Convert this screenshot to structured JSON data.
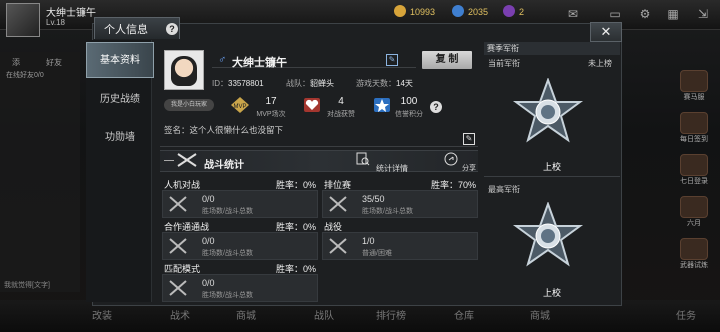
{
  "background": {
    "player_name": "大绅士镰午",
    "player_level": "Lv.18",
    "currency_1": "10993",
    "currency_2": "2035",
    "currency_3": "2",
    "left_tab_1": "添",
    "left_tab_2": "好友",
    "left_text": "在线好友0/0",
    "left_bottom_text": "我就觉得[文字]",
    "right_items": [
      "赛马服",
      "每日签到",
      "七日登录",
      "六月",
      "武器试炼"
    ],
    "bottom_nav": [
      "改装",
      "战术",
      "商城",
      "战队",
      "排行榜",
      "仓库",
      "商城",
      "任务"
    ]
  },
  "dialog": {
    "title": "个人信息",
    "help": "?",
    "close": "✕",
    "sidebar": [
      {
        "label": "基本资料",
        "active": true
      },
      {
        "label": "历史战绩",
        "active": false
      },
      {
        "label": "功勋墙",
        "active": false
      }
    ]
  },
  "profile": {
    "gender_symbol": "♂",
    "name": "大绅士镰午",
    "copy_label": "复 制",
    "id_label": "ID：",
    "id_value": "33578801",
    "team_label": "战队：",
    "team_value": "貂蝉头",
    "days_label": "游戏天数：",
    "days_value": "14天",
    "badge_text": "我是小白玩家",
    "stats": [
      {
        "value": "17",
        "label": "MVP场次",
        "icon": "mvp-icon"
      },
      {
        "value": "4",
        "label": "对战获赞",
        "icon": "heart-icon"
      },
      {
        "value": "100",
        "label": "信誉积分",
        "icon": "star-icon"
      }
    ],
    "signature": "签名：这个人很懒什么也没留下",
    "battle_title": "战斗统计",
    "detail_label": "统计详情",
    "share_label": "分享"
  },
  "battle_cards": [
    {
      "title": "人机对战",
      "rate": "胜率：0%",
      "value": "0/0",
      "sub": "胜场数/战斗总数"
    },
    {
      "title": "排位赛",
      "rate": "胜率：70%",
      "value": "35/50",
      "sub": "胜场数/战斗总数"
    },
    {
      "title": "合作通通战",
      "rate": "胜率：0%",
      "value": "0/0",
      "sub": "胜场数/战斗总数"
    },
    {
      "title": "战役",
      "rate": "",
      "value": "1/0",
      "sub": "普通/困难"
    },
    {
      "title": "匹配模式",
      "rate": "胜率：0%",
      "value": "0/0",
      "sub": "胜场数/战斗总数"
    }
  ],
  "rank": {
    "header": "赛季军衔",
    "current_label": "当前军衔",
    "current_status": "未上榜",
    "current_rank": "上校",
    "highest_label": "最高军衔",
    "highest_rank": "上校"
  },
  "colors": {
    "accent_blue": "#6fa7ff",
    "rank_metal": "#c7d2da",
    "active_tab": "#5a6a74"
  }
}
